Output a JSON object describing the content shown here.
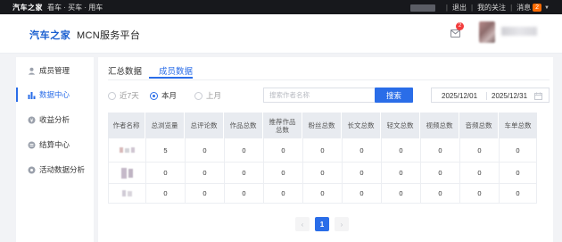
{
  "topbar": {
    "logo": "汽车之家",
    "links": "看车 · 买车 · 用车",
    "logout": "退出",
    "follow": "我的关注",
    "message": "消息",
    "message_count": "2"
  },
  "header": {
    "brand": "汽车之家",
    "title": "MCN服务平台",
    "mail_badge": "2"
  },
  "sidebar": {
    "items": [
      {
        "label": "成员管理",
        "icon": "user-icon"
      },
      {
        "label": "数据中心",
        "icon": "bar-chart-icon",
        "active": true
      },
      {
        "label": "收益分析",
        "icon": "coin-icon"
      },
      {
        "label": "结算中心",
        "icon": "settle-icon"
      },
      {
        "label": "活动数据分析",
        "icon": "activity-icon"
      }
    ]
  },
  "tabs": [
    {
      "label": "汇总数据"
    },
    {
      "label": "成员数据",
      "active": true
    }
  ],
  "filter": {
    "ranges": [
      "近7天",
      "本月",
      "上月"
    ],
    "selected": "本月",
    "search_placeholder": "搜索作者名称",
    "search_button": "搜索",
    "date_start": "2025/12/01",
    "date_end": "2025/12/31"
  },
  "table": {
    "headers": [
      "作者名称",
      "总浏览量",
      "总评论数",
      "作品总数",
      "推荐作品总数",
      "粉丝总数",
      "长文总数",
      "轻文总数",
      "视频总数",
      "音频总数",
      "车单总数"
    ],
    "rows": [
      [
        "",
        "5",
        "0",
        "0",
        "0",
        "0",
        "0",
        "0",
        "0",
        "0",
        "0"
      ],
      [
        "",
        "0",
        "0",
        "0",
        "0",
        "0",
        "0",
        "0",
        "0",
        "0",
        "0"
      ],
      [
        "",
        "0",
        "0",
        "0",
        "0",
        "0",
        "0",
        "0",
        "0",
        "0",
        "0"
      ]
    ]
  },
  "pagination": {
    "prev": "‹",
    "current": "1",
    "next": "›"
  },
  "colors": {
    "accent": "#2a6de8",
    "topbar": "#17181c",
    "badge_red": "#f23d3d",
    "badge_orange": "#ff6a00"
  }
}
